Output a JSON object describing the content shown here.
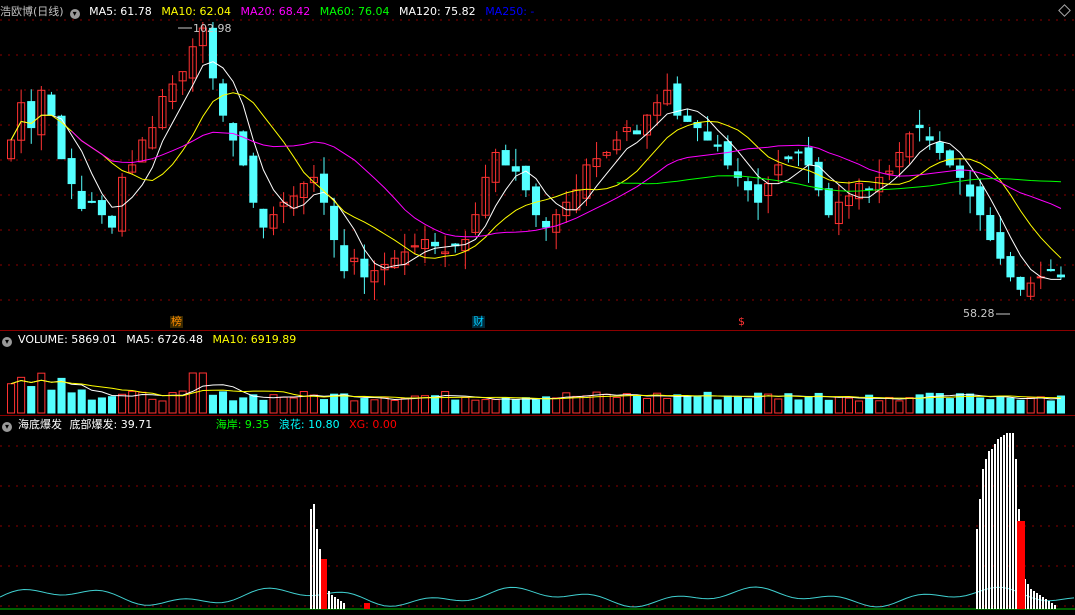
{
  "price_pane": {
    "stock_name": "浩欧博(日线)",
    "ma_labels": [
      {
        "text": "MA5: 61.78",
        "color": "#ffffff"
      },
      {
        "text": "MA10: 62.04",
        "color": "#ffff00"
      },
      {
        "text": "MA20: 68.42",
        "color": "#ff00ff"
      },
      {
        "text": "MA60: 76.04",
        "color": "#00ff00"
      },
      {
        "text": "MA120: 75.82",
        "color": "#ffffff"
      },
      {
        "text": "MA250: -",
        "color": "#0000ff"
      }
    ],
    "high_label": "102.98",
    "low_label": "58.28",
    "markers": [
      {
        "text": "榜",
        "color": "#ff8c00"
      },
      {
        "text": "财",
        "color": "#00ccff"
      },
      {
        "text": "$",
        "color": "#ff3333"
      }
    ]
  },
  "volume_pane": {
    "label": "VOLUME: 5869.01",
    "ma_labels": [
      {
        "text": "MA5: 6726.48",
        "color": "#ffffff"
      },
      {
        "text": "MA10: 6919.89",
        "color": "#ffff00"
      }
    ]
  },
  "indicator_pane": {
    "name": "海底爆发",
    "values": [
      {
        "text": "底部爆发: 39.71",
        "color": "#ffffff"
      },
      {
        "text": "海岸: 9.35",
        "color": "#00ff00"
      },
      {
        "text": "浪花: 10.80",
        "color": "#00ffff"
      },
      {
        "text": "XG: 0.00",
        "color": "#ff0000"
      }
    ]
  },
  "colors": {
    "up": "#ff3232",
    "down": "#54ffff",
    "grid": "#8b0000",
    "ma5": "#ffffff",
    "ma10": "#ffff00",
    "ma20": "#ff00ff",
    "ma60": "#00ff00"
  },
  "chart_data": {
    "type": "candlestick",
    "price_high": 102.98,
    "price_low": 58.28,
    "closes": [
      84,
      90,
      86,
      92,
      88,
      81,
      77,
      73,
      74,
      72,
      70,
      78,
      80,
      84,
      86,
      91,
      93,
      95,
      99,
      102,
      94,
      88,
      84,
      80,
      74,
      70,
      72,
      74,
      75,
      77,
      78,
      74,
      68,
      63,
      65,
      62,
      63,
      64,
      65,
      66,
      67,
      68,
      67,
      66,
      67,
      68,
      72,
      78,
      82,
      80,
      79,
      76,
      72,
      70,
      72,
      74,
      76,
      80,
      81,
      82,
      84,
      86,
      85,
      88,
      90,
      92,
      88,
      87,
      86,
      84,
      83,
      80,
      78,
      76,
      74,
      77,
      80,
      81,
      82,
      80,
      76,
      72,
      74,
      75,
      77,
      76,
      78,
      79,
      82,
      85,
      86,
      84,
      82,
      80,
      78,
      75,
      72,
      68,
      65,
      62,
      60,
      61,
      62,
      63,
      62
    ]
  }
}
